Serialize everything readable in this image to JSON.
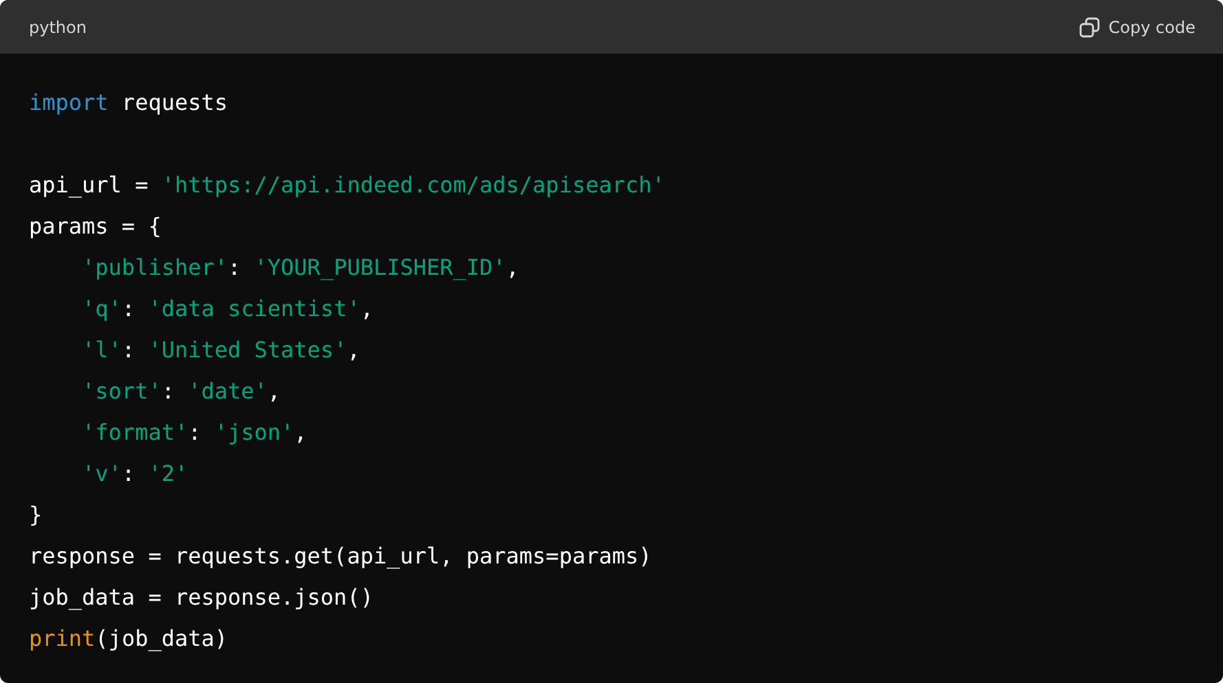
{
  "header": {
    "language": "python",
    "copy_button": "Copy code"
  },
  "lines": [
    {
      "kind": "code",
      "tokens": [
        {
          "kind": "keyword",
          "text": "import"
        },
        {
          "kind": "plain",
          "text": " requests"
        }
      ]
    },
    {
      "kind": "blank"
    },
    {
      "kind": "code",
      "tokens": [
        {
          "kind": "plain",
          "text": "api_url = "
        },
        {
          "kind": "string",
          "text": "'https://api.indeed.com/ads/apisearch'"
        }
      ]
    },
    {
      "kind": "code",
      "tokens": [
        {
          "kind": "plain",
          "text": "params = {"
        }
      ]
    },
    {
      "kind": "indented",
      "tokens": [
        {
          "kind": "string",
          "text": "'publisher'"
        },
        {
          "kind": "plain",
          "text": ": "
        },
        {
          "kind": "string",
          "text": "'YOUR_PUBLISHER_ID'"
        },
        {
          "kind": "plain",
          "text": ","
        }
      ]
    },
    {
      "kind": "indented",
      "tokens": [
        {
          "kind": "string",
          "text": "'q'"
        },
        {
          "kind": "plain",
          "text": ": "
        },
        {
          "kind": "string",
          "text": "'data scientist'"
        },
        {
          "kind": "plain",
          "text": ","
        }
      ]
    },
    {
      "kind": "indented",
      "tokens": [
        {
          "kind": "string",
          "text": "'l'"
        },
        {
          "kind": "plain",
          "text": ": "
        },
        {
          "kind": "string",
          "text": "'United States'"
        },
        {
          "kind": "plain",
          "text": ","
        }
      ]
    },
    {
      "kind": "indented",
      "tokens": [
        {
          "kind": "string",
          "text": "'sort'"
        },
        {
          "kind": "plain",
          "text": ": "
        },
        {
          "kind": "string",
          "text": "'date'"
        },
        {
          "kind": "plain",
          "text": ","
        }
      ]
    },
    {
      "kind": "indented",
      "tokens": [
        {
          "kind": "string",
          "text": "'format'"
        },
        {
          "kind": "plain",
          "text": ": "
        },
        {
          "kind": "string",
          "text": "'json'"
        },
        {
          "kind": "plain",
          "text": ","
        }
      ]
    },
    {
      "kind": "indented",
      "tokens": [
        {
          "kind": "string",
          "text": "'v'"
        },
        {
          "kind": "plain",
          "text": ": "
        },
        {
          "kind": "string",
          "text": "'2'"
        }
      ]
    },
    {
      "kind": "code",
      "tokens": [
        {
          "kind": "plain",
          "text": "}"
        }
      ]
    },
    {
      "kind": "code",
      "tokens": [
        {
          "kind": "plain",
          "text": "response = requests.get(api_url, params=params)"
        }
      ]
    },
    {
      "kind": "code",
      "tokens": [
        {
          "kind": "plain",
          "text": "job_data = response.json()"
        }
      ]
    },
    {
      "kind": "code",
      "tokens": [
        {
          "kind": "builtin",
          "text": "print"
        },
        {
          "kind": "plain",
          "text": "(job_data)"
        }
      ]
    }
  ]
}
